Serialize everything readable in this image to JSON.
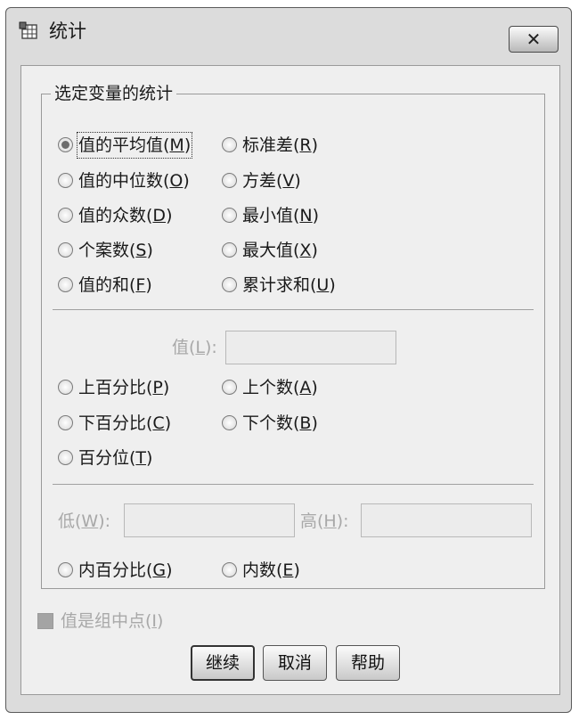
{
  "window": {
    "title": "统计",
    "close_label": "✕"
  },
  "group": {
    "legend": "选定变量的统计"
  },
  "options": [
    {
      "text": "值的平均值(",
      "key": "M",
      "selected": true,
      "focused": true
    },
    {
      "text": "标准差(",
      "key": "R"
    },
    {
      "text": "值的中位数(",
      "key": "O"
    },
    {
      "text": "方差(",
      "key": "V"
    },
    {
      "text": "值的众数(",
      "key": "D"
    },
    {
      "text": "最小值(",
      "key": "N"
    },
    {
      "text": "个案数(",
      "key": "S"
    },
    {
      "text": "最大值(",
      "key": "X"
    },
    {
      "text": "值的和(",
      "key": "F"
    },
    {
      "text": "累计求和(",
      "key": "U"
    },
    {
      "text": "上百分比(",
      "key": "P"
    },
    {
      "text": "上个数(",
      "key": "A"
    },
    {
      "text": "下百分比(",
      "key": "C"
    },
    {
      "text": "下个数(",
      "key": "B"
    },
    {
      "text": "百分位(",
      "key": "T"
    },
    {
      "text": "内百分比(",
      "key": "G"
    },
    {
      "text": "内数(",
      "key": "E"
    }
  ],
  "fields": {
    "value": {
      "text": "值(",
      "key": "L",
      "suffix": "):",
      "value": ""
    },
    "low": {
      "text": "低(",
      "key": "W",
      "suffix": "):",
      "value": ""
    },
    "high": {
      "text": "高(",
      "key": "H",
      "suffix": "):",
      "value": ""
    }
  },
  "checkbox": {
    "text": "值是组中点(",
    "key": "I",
    "suffix": ")",
    "checked": false
  },
  "buttons": {
    "continue": "继续",
    "cancel": "取消",
    "help": "帮助"
  }
}
